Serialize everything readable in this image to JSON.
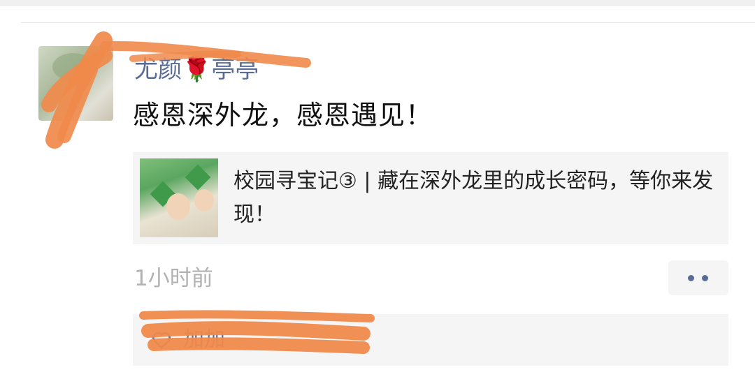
{
  "post": {
    "nickname": "尤颜🌹亭亭",
    "text": "感恩深外龙，感恩遇见！",
    "share": {
      "title": "校园寻宝记③ | 藏在深外龙里的成长密码，等你来发现！"
    },
    "timestamp": "1小时前",
    "likes": {
      "names": "加加"
    }
  },
  "colors": {
    "name_blue": "#576b95",
    "redaction_orange": "#f08a4b",
    "card_bg": "#f5f5f5",
    "meta_gray": "#b2b2b2"
  },
  "icons": {
    "more": "more-dots-icon",
    "like": "heart-icon"
  }
}
